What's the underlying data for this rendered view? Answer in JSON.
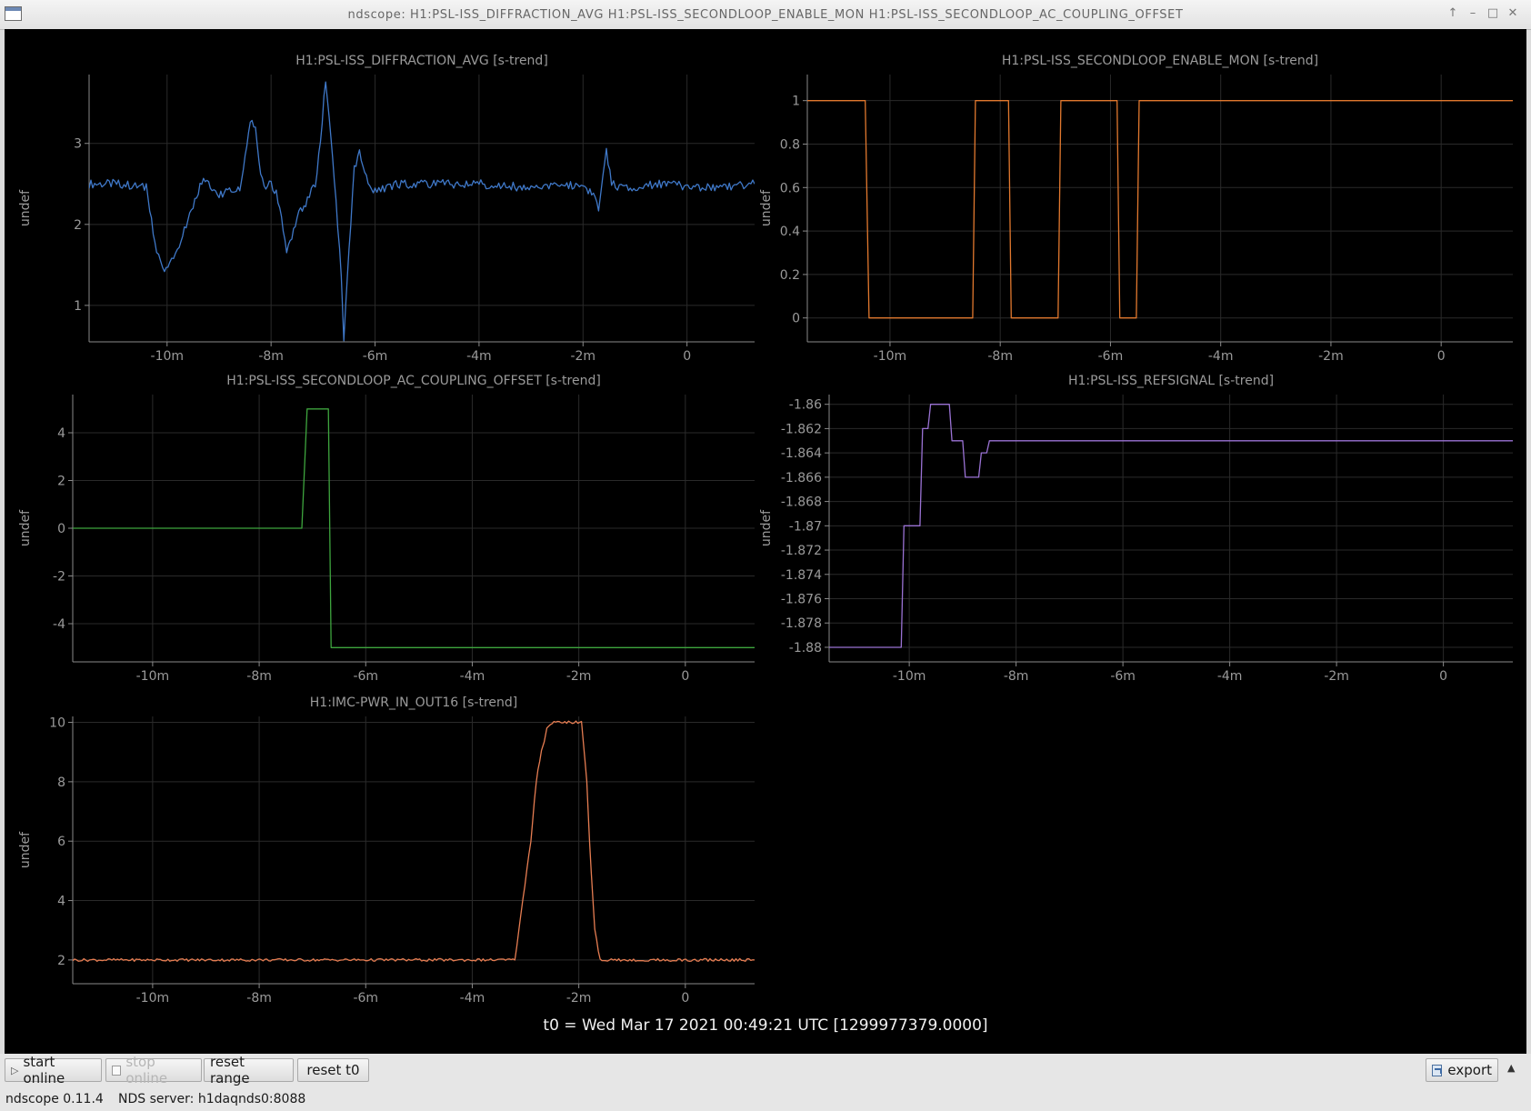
{
  "window": {
    "title": "ndscope: H1:PSL-ISS_DIFFRACTION_AVG H1:PSL-ISS_SECONDLOOP_ENABLE_MON H1:PSL-ISS_SECONDLOOP_AC_COUPLING_OFFSET",
    "controls": [
      "↑",
      "–",
      "□",
      "✕"
    ]
  },
  "t0_label": "t0 = Wed Mar 17 2021 00:49:21 UTC [1299977379.0000]",
  "toolbar": {
    "start_online": "start online",
    "stop_online": "stop online",
    "reset_range": "reset range",
    "reset_t0": "reset t0",
    "export": "export"
  },
  "status": {
    "version": "ndscope 0.11.4",
    "server": "NDS server: h1daqnds0:8088"
  },
  "chart_data": [
    {
      "type": "line",
      "title": "H1:PSL-ISS_DIFFRACTION_AVG [s-trend]",
      "ylabel": "undef",
      "color": "#3f78c8",
      "xlim": [
        -11.5,
        1.3
      ],
      "ylim": [
        0.55,
        3.85
      ],
      "xticks": [
        -10,
        -8,
        -6,
        -4,
        -2,
        0
      ],
      "xtick_labels": [
        "-10m",
        "-8m",
        "-6m",
        "-4m",
        "-2m",
        "0"
      ],
      "yticks": [
        1,
        2,
        3
      ],
      "ytick_labels": [
        "1",
        "2",
        "3"
      ],
      "grid": true,
      "noise": 0.05,
      "series": [
        {
          "x": [
            -11.5,
            -10.9,
            -10.4,
            -10.2,
            -10.05,
            -9.95,
            -9.8,
            -9.5,
            -9.3,
            -9.0,
            -8.8,
            -8.6,
            -8.5,
            -8.4,
            -8.3,
            -8.2,
            -8.1,
            -8.0,
            -7.9,
            -7.8,
            -7.7,
            -7.6,
            -7.5,
            -7.3,
            -7.15,
            -7.05,
            -6.95,
            -6.85,
            -6.75,
            -6.65,
            -6.6,
            -6.5,
            -6.4,
            -6.3,
            -6.2,
            -6.0,
            -5.6,
            -4.0,
            -3.0,
            -2.0,
            -1.8,
            -1.7,
            -1.65,
            -1.55,
            -1.45,
            -1.3,
            -0.5,
            0.5,
            1.3
          ],
          "y": [
            2.5,
            2.5,
            2.45,
            1.65,
            1.4,
            1.5,
            1.7,
            2.2,
            2.6,
            2.35,
            2.45,
            2.4,
            2.8,
            3.3,
            3.2,
            2.6,
            2.45,
            2.5,
            2.4,
            2.1,
            1.65,
            1.85,
            2.1,
            2.3,
            2.5,
            3.0,
            3.8,
            3.1,
            2.3,
            1.4,
            0.6,
            1.7,
            2.7,
            2.9,
            2.6,
            2.4,
            2.5,
            2.5,
            2.45,
            2.5,
            2.35,
            2.2,
            2.4,
            2.9,
            2.5,
            2.45,
            2.5,
            2.45,
            2.5
          ]
        }
      ]
    },
    {
      "type": "line",
      "title": "H1:PSL-ISS_SECONDLOOP_ENABLE_MON [s-trend]",
      "ylabel": "undef",
      "color": "#e1782e",
      "xlim": [
        -11.5,
        1.3
      ],
      "ylim": [
        -0.11,
        1.12
      ],
      "xticks": [
        -10,
        -8,
        -6,
        -4,
        -2,
        0
      ],
      "xtick_labels": [
        "-10m",
        "-8m",
        "-6m",
        "-4m",
        "-2m",
        "0"
      ],
      "yticks": [
        0,
        0.2,
        0.4,
        0.6,
        0.8,
        1
      ],
      "ytick_labels": [
        "0",
        "0.2",
        "0.4",
        "0.6",
        "0.8",
        "1"
      ],
      "grid": true,
      "noise": 0,
      "series": [
        {
          "x": [
            -11.5,
            -10.45,
            -10.38,
            -8.5,
            -8.45,
            -7.85,
            -7.8,
            -6.95,
            -6.9,
            -5.88,
            -5.83,
            -5.53,
            -5.48,
            1.3
          ],
          "y": [
            1,
            1,
            0,
            0,
            1,
            1,
            0,
            0,
            1,
            1,
            0,
            0,
            1,
            1
          ]
        }
      ]
    },
    {
      "type": "line",
      "title": "H1:PSL-ISS_SECONDLOOP_AC_COUPLING_OFFSET [s-trend]",
      "ylabel": "undef",
      "color": "#3ea53e",
      "xlim": [
        -11.5,
        1.3
      ],
      "ylim": [
        -5.6,
        5.6
      ],
      "xticks": [
        -10,
        -8,
        -6,
        -4,
        -2,
        0
      ],
      "xtick_labels": [
        "-10m",
        "-8m",
        "-6m",
        "-4m",
        "-2m",
        "0"
      ],
      "yticks": [
        -4,
        -2,
        0,
        2,
        4
      ],
      "ytick_labels": [
        "-4",
        "-2",
        "0",
        "2",
        "4"
      ],
      "grid": true,
      "noise": 0,
      "series": [
        {
          "x": [
            -11.5,
            -7.2,
            -7.1,
            -6.7,
            -6.65,
            1.3
          ],
          "y": [
            0,
            0,
            5,
            5,
            -5,
            -5
          ]
        }
      ]
    },
    {
      "type": "line",
      "title": "H1:PSL-ISS_REFSIGNAL [s-trend]",
      "ylabel": "undef",
      "color": "#9a72d4",
      "xlim": [
        -11.5,
        1.3
      ],
      "ylim": [
        -1.8812,
        -1.8592
      ],
      "xticks": [
        -10,
        -8,
        -6,
        -4,
        -2,
        0
      ],
      "xtick_labels": [
        "-10m",
        "-8m",
        "-6m",
        "-4m",
        "-2m",
        "0"
      ],
      "yticks": [
        -1.88,
        -1.878,
        -1.876,
        -1.874,
        -1.872,
        -1.87,
        -1.868,
        -1.866,
        -1.864,
        -1.862,
        -1.86
      ],
      "ytick_labels": [
        "-1.88",
        "-1.878",
        "-1.876",
        "-1.874",
        "-1.872",
        "-1.87",
        "-1.868",
        "-1.866",
        "-1.864",
        "-1.862",
        "-1.86"
      ],
      "grid": true,
      "noise": 0,
      "series": [
        {
          "x": [
            -11.5,
            -10.15,
            -10.1,
            -9.8,
            -9.75,
            -9.65,
            -9.6,
            -9.25,
            -9.2,
            -9.0,
            -8.95,
            -8.7,
            -8.65,
            -8.55,
            -8.5,
            1.3
          ],
          "y": [
            -1.88,
            -1.88,
            -1.87,
            -1.87,
            -1.862,
            -1.862,
            -1.86,
            -1.86,
            -1.863,
            -1.863,
            -1.866,
            -1.866,
            -1.864,
            -1.864,
            -1.863,
            -1.863
          ]
        }
      ]
    },
    {
      "type": "line",
      "title": "H1:IMC-PWR_IN_OUT16 [s-trend]",
      "ylabel": "undef",
      "color": "#e67d52",
      "xlim": [
        -11.5,
        1.3
      ],
      "ylim": [
        1.2,
        10.2
      ],
      "xticks": [
        -10,
        -8,
        -6,
        -4,
        -2,
        0
      ],
      "xtick_labels": [
        "-10m",
        "-8m",
        "-6m",
        "-4m",
        "-2m",
        "0"
      ],
      "yticks": [
        2,
        4,
        6,
        8,
        10
      ],
      "ytick_labels": [
        "2",
        "4",
        "6",
        "8",
        "10"
      ],
      "grid": true,
      "noise": 0.015,
      "series": [
        {
          "x": [
            -11.5,
            -3.2,
            -3.05,
            -2.9,
            -2.8,
            -2.7,
            -2.65,
            -2.6,
            -2.5,
            -2.4,
            -1.95,
            -1.85,
            -1.8,
            -1.7,
            -1.6,
            1.3
          ],
          "y": [
            2,
            2,
            4,
            6,
            8,
            9.1,
            9.3,
            9.8,
            10,
            10,
            10,
            8,
            6,
            3,
            2,
            2
          ]
        }
      ]
    }
  ]
}
